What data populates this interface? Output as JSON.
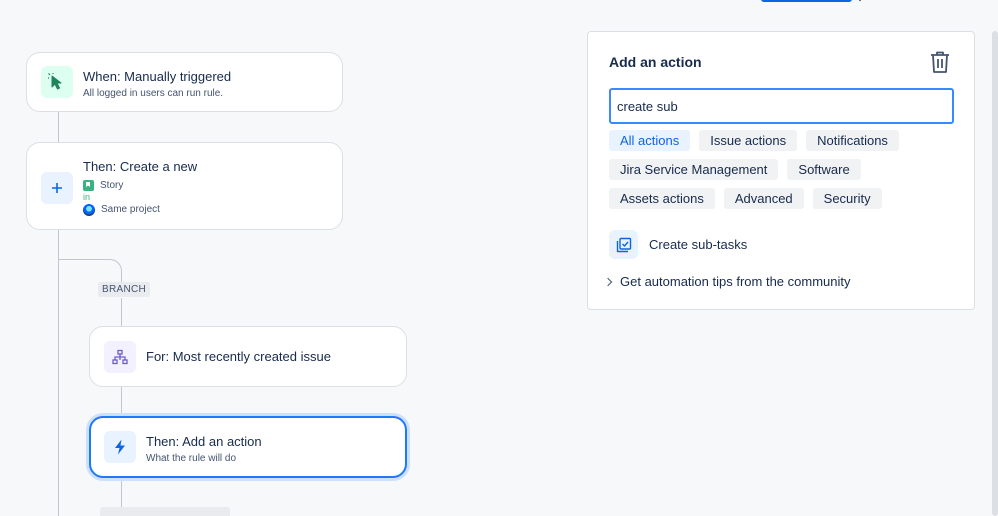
{
  "flow": {
    "trigger": {
      "title": "When: Manually triggered",
      "subtitle": "All logged in users can run rule."
    },
    "create": {
      "title": "Then: Create a new",
      "issue_type": "Story",
      "in_label": "in",
      "project": "Same project"
    },
    "branch": {
      "label": "BRANCH"
    },
    "for_item": {
      "title": "For: Most recently created issue"
    },
    "add_action": {
      "title": "Then: Add an action",
      "subtitle": "What the rule will do"
    }
  },
  "panel": {
    "title": "Add an action",
    "search": {
      "value": "create sub",
      "placeholder": ""
    },
    "chips": [
      [
        "All actions",
        "Issue actions",
        "Notifications"
      ],
      [
        "Jira Service Management",
        "Software"
      ],
      [
        "Assets actions",
        "Advanced",
        "Security"
      ]
    ],
    "active_chip": "All actions",
    "result": {
      "label": "Create sub-tasks",
      "icon": "subtask-icon"
    },
    "tips": "Get automation tips from the community"
  },
  "colors": {
    "accent": "#0c66e4",
    "focus": "#388bff",
    "trigger_bg": "#dcfff1",
    "selected_border": "#1d7afc"
  }
}
